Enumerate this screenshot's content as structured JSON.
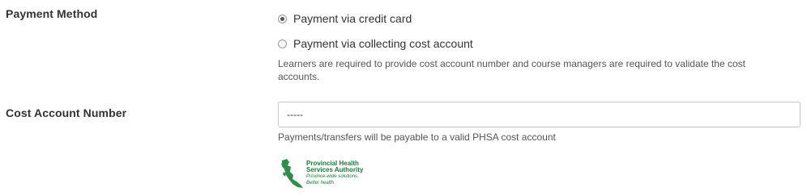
{
  "payment": {
    "label": "Payment Method",
    "options": [
      {
        "label": "Payment via credit card",
        "selected": true
      },
      {
        "label": "Payment via collecting cost account",
        "selected": false
      }
    ],
    "help_line1": "Learners are required to provide cost account number and course managers are required to validate the cost",
    "help_line2": "accounts."
  },
  "cost_account": {
    "label": "Cost Account Number",
    "value": "-----",
    "help": "Payments/transfers will be payable to a valid PHSA cost account"
  },
  "logo": {
    "line1": "Provincial Health",
    "line2": "Services Authority",
    "tagline1": "Province-wide solutions.",
    "tagline2": "Better health.",
    "color": "#1a7a3b"
  }
}
